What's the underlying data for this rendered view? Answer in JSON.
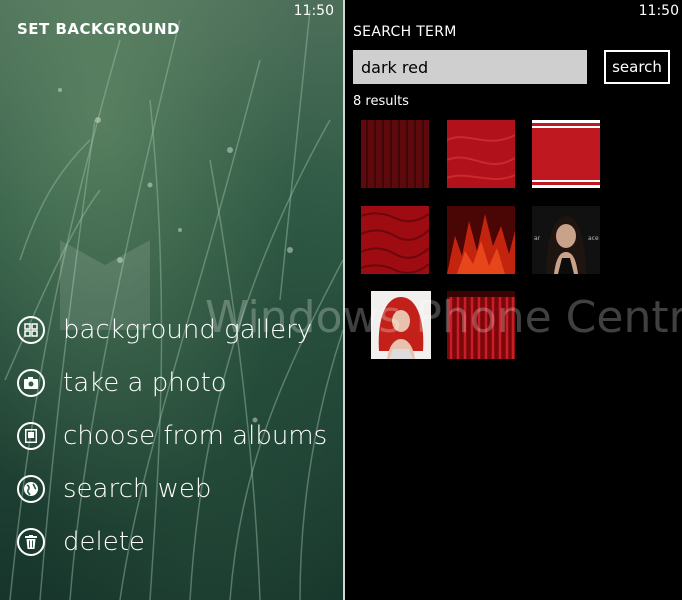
{
  "left_panel": {
    "clock": "11:50",
    "title": "SET BACKGROUND",
    "menu": [
      {
        "label": "background gallery",
        "icon": "grid-icon"
      },
      {
        "label": "take a photo",
        "icon": "camera-icon"
      },
      {
        "label": "choose from albums",
        "icon": "album-icon"
      },
      {
        "label": "search web",
        "icon": "globe-icon"
      },
      {
        "label": "delete",
        "icon": "trash-icon"
      }
    ]
  },
  "right_panel": {
    "clock": "11:50",
    "search_label": "SEARCH TERM",
    "search_value": "dark red",
    "search_button": "search",
    "results_count": "8 results",
    "results": [
      {
        "kind": "dark-red-stripes-texture"
      },
      {
        "kind": "red-fur-texture"
      },
      {
        "kind": "red-banner-stripes"
      },
      {
        "kind": "red-rough-texture"
      },
      {
        "kind": "red-flames-texture"
      },
      {
        "kind": "woman-photo-dark-hair"
      },
      {
        "kind": "woman-photo-red-hair"
      },
      {
        "kind": "red-curtain-texture"
      }
    ]
  },
  "watermark": "Windows Phone Central",
  "colors": {
    "accent": "#c0141a",
    "background": "#000000",
    "input_bg": "#cfcfcf"
  }
}
